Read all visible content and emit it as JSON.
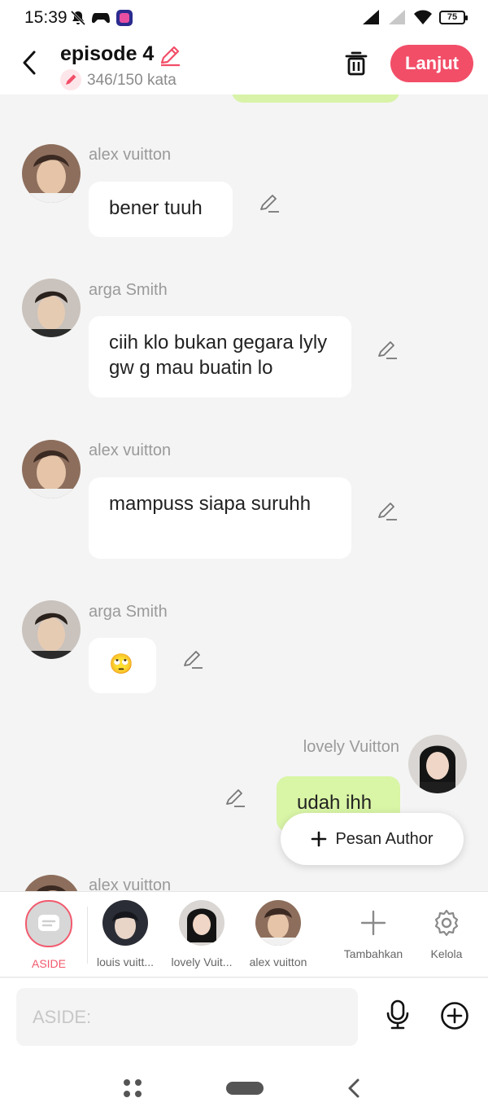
{
  "status_bar": {
    "time": "15:39",
    "battery": "75",
    "icons": [
      "bell-off-icon",
      "gamepad-icon",
      "app-icon",
      "signal-icon",
      "signal-weak-icon",
      "wifi-icon",
      "battery-icon"
    ]
  },
  "header": {
    "title": "episode 4",
    "word_count": "346/150 kata",
    "next_button": "Lanjut",
    "accent_color": "#f24e68"
  },
  "messages": [
    {
      "sender": "alex vuitton",
      "side": "left",
      "text": "bener tuuh"
    },
    {
      "sender": "arga Smith",
      "side": "left",
      "text": "ciih klo bukan gegara lyly gw g mau buatin lo"
    },
    {
      "sender": "alex vuitton",
      "side": "left",
      "text": "mampuss siapa suruhh"
    },
    {
      "sender": "arga Smith",
      "side": "left",
      "text": "🙄"
    },
    {
      "sender": "lovely Vuitton",
      "side": "right",
      "text": "udah ihh"
    },
    {
      "sender": "alex vuitton",
      "side": "left",
      "text": ""
    }
  ],
  "floating_button": {
    "label": "Pesan Author"
  },
  "characters": {
    "aside": "ASIDE",
    "items": [
      {
        "label": "louis vuitt..."
      },
      {
        "label": "lovely Vuit..."
      },
      {
        "label": "alex vuitton"
      }
    ],
    "add_label": "Tambahkan",
    "manage_label": "Kelola"
  },
  "input": {
    "placeholder": "ASIDE:",
    "value": ""
  },
  "colors": {
    "bubble_right": "#d9f5a6",
    "chat_bg": "#f4f4f4"
  }
}
